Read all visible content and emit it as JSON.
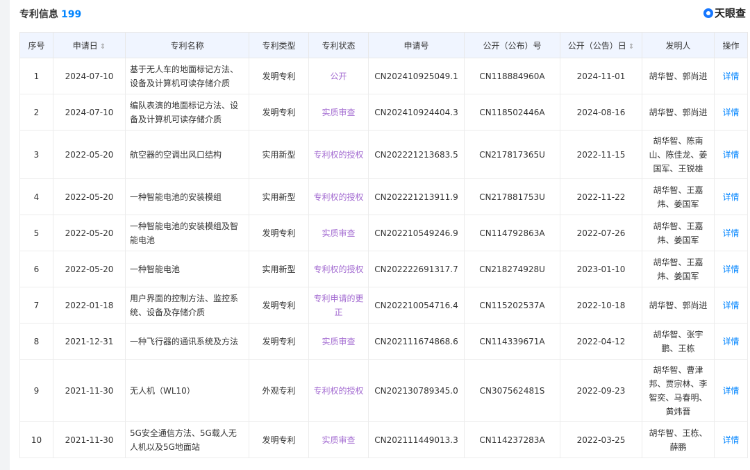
{
  "header": {
    "title": "专利信息",
    "count": "199",
    "brand": "天眼查"
  },
  "columns": [
    "序号",
    "申请日",
    "专利名称",
    "专利类型",
    "专利状态",
    "申请号",
    "公开（公布）号",
    "公开（公告）日",
    "发明人",
    "操作"
  ],
  "sort_icon": "⇕",
  "rows": [
    {
      "no": "1",
      "date": "2024-07-10",
      "name": "基于无人车的地面标记方法、设备及计算机可读存储介质",
      "type": "发明专利",
      "status": "公开",
      "app_no": "CN202410925049.1",
      "pub_no": "CN118884960A",
      "pub_date": "2024-11-01",
      "inventors": "胡华智、郭尚进",
      "action": "详情"
    },
    {
      "no": "2",
      "date": "2024-07-10",
      "name": "编队表演的地面标记方法、设备及计算机可读存储介质",
      "type": "发明专利",
      "status": "实质审查",
      "app_no": "CN202410924404.3",
      "pub_no": "CN118502446A",
      "pub_date": "2024-08-16",
      "inventors": "胡华智、郭尚进",
      "action": "详情"
    },
    {
      "no": "3",
      "date": "2022-05-20",
      "name": "航空器的空调出风口结构",
      "type": "实用新型",
      "status": "专利权的授权",
      "app_no": "CN202221213683.5",
      "pub_no": "CN217817365U",
      "pub_date": "2022-11-15",
      "inventors": "胡华智、陈南山、陈佳龙、姜国军、王锐雄",
      "action": "详情"
    },
    {
      "no": "4",
      "date": "2022-05-20",
      "name": "一种智能电池的安装模组",
      "type": "实用新型",
      "status": "专利权的授权",
      "app_no": "CN202221213911.9",
      "pub_no": "CN217881753U",
      "pub_date": "2022-11-22",
      "inventors": "胡华智、王嘉炜、姜国军",
      "action": "详情"
    },
    {
      "no": "5",
      "date": "2022-05-20",
      "name": "一种智能电池的安装模组及智能电池",
      "type": "发明专利",
      "status": "实质审查",
      "app_no": "CN202210549246.9",
      "pub_no": "CN114792863A",
      "pub_date": "2022-07-26",
      "inventors": "胡华智、王嘉炜、姜国军",
      "action": "详情"
    },
    {
      "no": "6",
      "date": "2022-05-20",
      "name": "一种智能电池",
      "type": "实用新型",
      "status": "专利权的授权",
      "app_no": "CN202222691317.7",
      "pub_no": "CN218274928U",
      "pub_date": "2023-01-10",
      "inventors": "胡华智、王嘉炜、姜国军",
      "action": "详情"
    },
    {
      "no": "7",
      "date": "2022-01-18",
      "name": "用户界面的控制方法、监控系统、设备及存储介质",
      "type": "发明专利",
      "status": "专利申请的更正",
      "app_no": "CN202210054716.4",
      "pub_no": "CN115202537A",
      "pub_date": "2022-10-18",
      "inventors": "胡华智、郭尚进",
      "action": "详情"
    },
    {
      "no": "8",
      "date": "2021-12-31",
      "name": "一种飞行器的通讯系统及方法",
      "type": "发明专利",
      "status": "实质审查",
      "app_no": "CN202111674868.6",
      "pub_no": "CN114339671A",
      "pub_date": "2022-04-12",
      "inventors": "胡华智、张宇鹏、王栋",
      "action": "详情"
    },
    {
      "no": "9",
      "date": "2021-11-30",
      "name": "无人机（WL10）",
      "type": "外观专利",
      "status": "专利权的授权",
      "app_no": "CN202130789345.0",
      "pub_no": "CN307562481S",
      "pub_date": "2022-09-23",
      "inventors": "胡华智、曹津邦、贾宗林、李智奕、马春明、黄炜晋",
      "action": "详情"
    },
    {
      "no": "10",
      "date": "2021-11-30",
      "name": "5G安全通信方法、5G载人无人机以及5G地面站",
      "type": "发明专利",
      "status": "实质审查",
      "app_no": "CN202111449013.3",
      "pub_no": "CN114237283A",
      "pub_date": "2022-03-25",
      "inventors": "胡华智、王栋、薛鹏",
      "action": "详情"
    }
  ]
}
